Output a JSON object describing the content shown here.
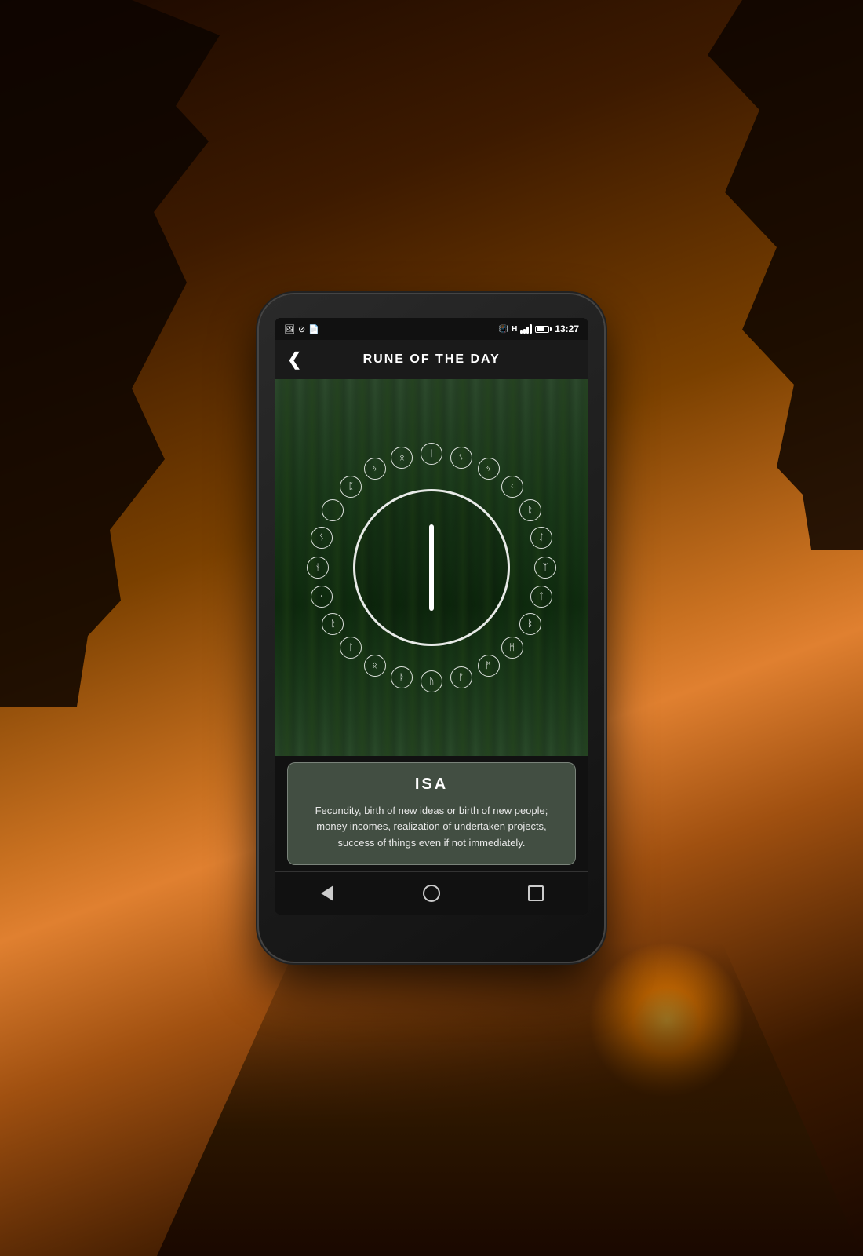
{
  "background": {
    "colors": [
      "#1a0800",
      "#3d1a00",
      "#7a4000",
      "#c87020",
      "#e08030"
    ]
  },
  "phone": {
    "status_bar": {
      "time": "13:27",
      "icons_left": [
        "image-icon",
        "shield-icon",
        "file-icon"
      ],
      "icons_right": [
        "vibrate-icon",
        "h-icon",
        "signal-icon",
        "battery-icon"
      ]
    },
    "app_bar": {
      "back_label": "‹",
      "title": "RUNE OF THE DAY"
    },
    "rune_display": {
      "rune_name": "ISA",
      "rune_description": "Fecundity, birth of new ideas or birth of new people; money incomes, realization of undertaken projects, success of things even if not immediately.",
      "rune_symbols": [
        "ᛁ",
        "ᛊ",
        "ᛃ",
        "ᚲ",
        "ᚱ",
        "ᛇ",
        "ᛉ",
        "ᛏ",
        "ᛒ",
        "ᛗ",
        "ᛗ",
        "ᚠ",
        "ᚢ",
        "ᚦ",
        "ᛟ",
        "ᛚ",
        "ᚱ",
        "ᚲ",
        "ᚾ",
        "ᛊ",
        "ᛁ",
        "ᛈ",
        "ᛃ",
        "ᛟ"
      ]
    },
    "nav_bar": {
      "back_label": "◁",
      "home_label": "○",
      "recents_label": "□"
    }
  }
}
